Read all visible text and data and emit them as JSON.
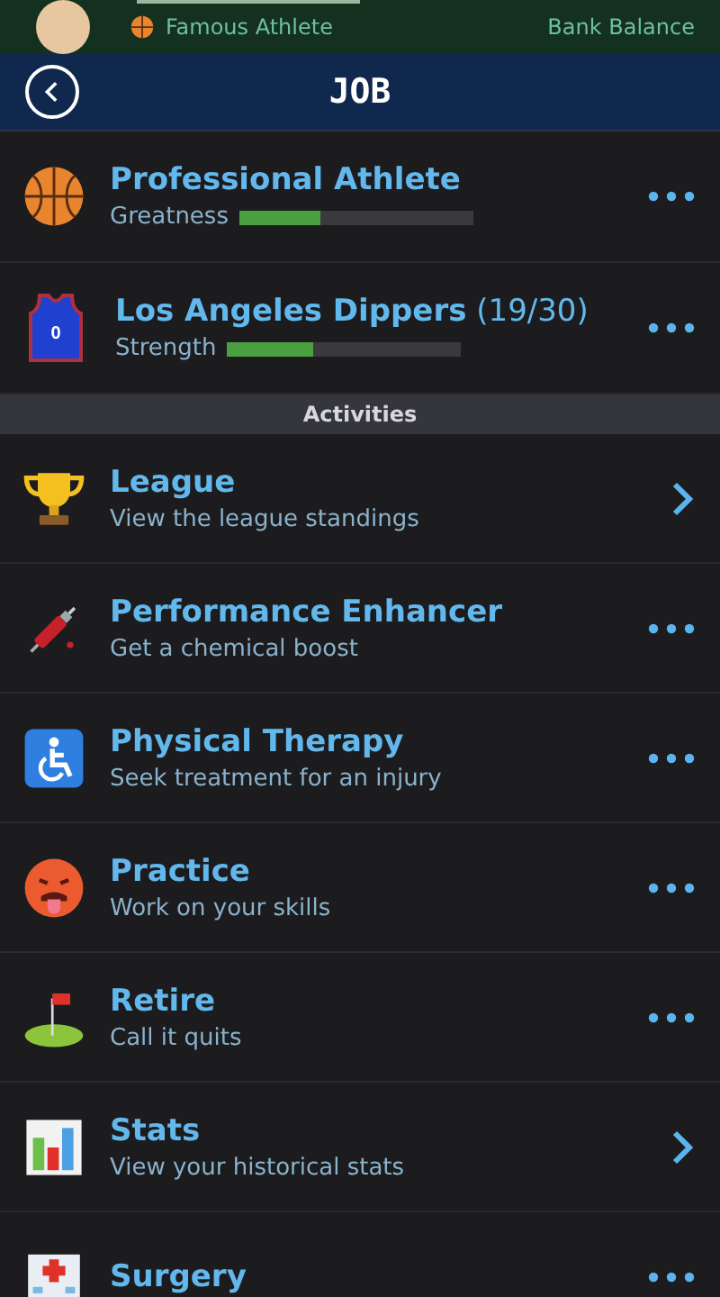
{
  "status_strip": {
    "subtitle": "Famous Athlete",
    "right_label": "Bank Balance"
  },
  "header": {
    "title": "JOB"
  },
  "career": [
    {
      "title": "Professional Athlete",
      "meter_label": "Greatness",
      "level": 0.35
    },
    {
      "title": "Los Angeles Dippers",
      "record": "(19/30)",
      "jersey_number": "0",
      "meter_label": "Strength",
      "level": 0.37
    }
  ],
  "section": {
    "title": "Activities"
  },
  "activities": [
    {
      "title": "League",
      "subtitle": "View the league standings",
      "kind": "chevron"
    },
    {
      "title": "Performance Enhancer",
      "subtitle": "Get a chemical boost",
      "kind": "more"
    },
    {
      "title": "Physical Therapy",
      "subtitle": "Seek treatment for an injury",
      "kind": "more"
    },
    {
      "title": "Practice",
      "subtitle": "Work on your skills",
      "kind": "more"
    },
    {
      "title": "Retire",
      "subtitle": "Call it quits",
      "kind": "more"
    },
    {
      "title": "Stats",
      "subtitle": "View your historical stats",
      "kind": "chevron"
    },
    {
      "title": "Surgery",
      "kind": "more"
    }
  ]
}
